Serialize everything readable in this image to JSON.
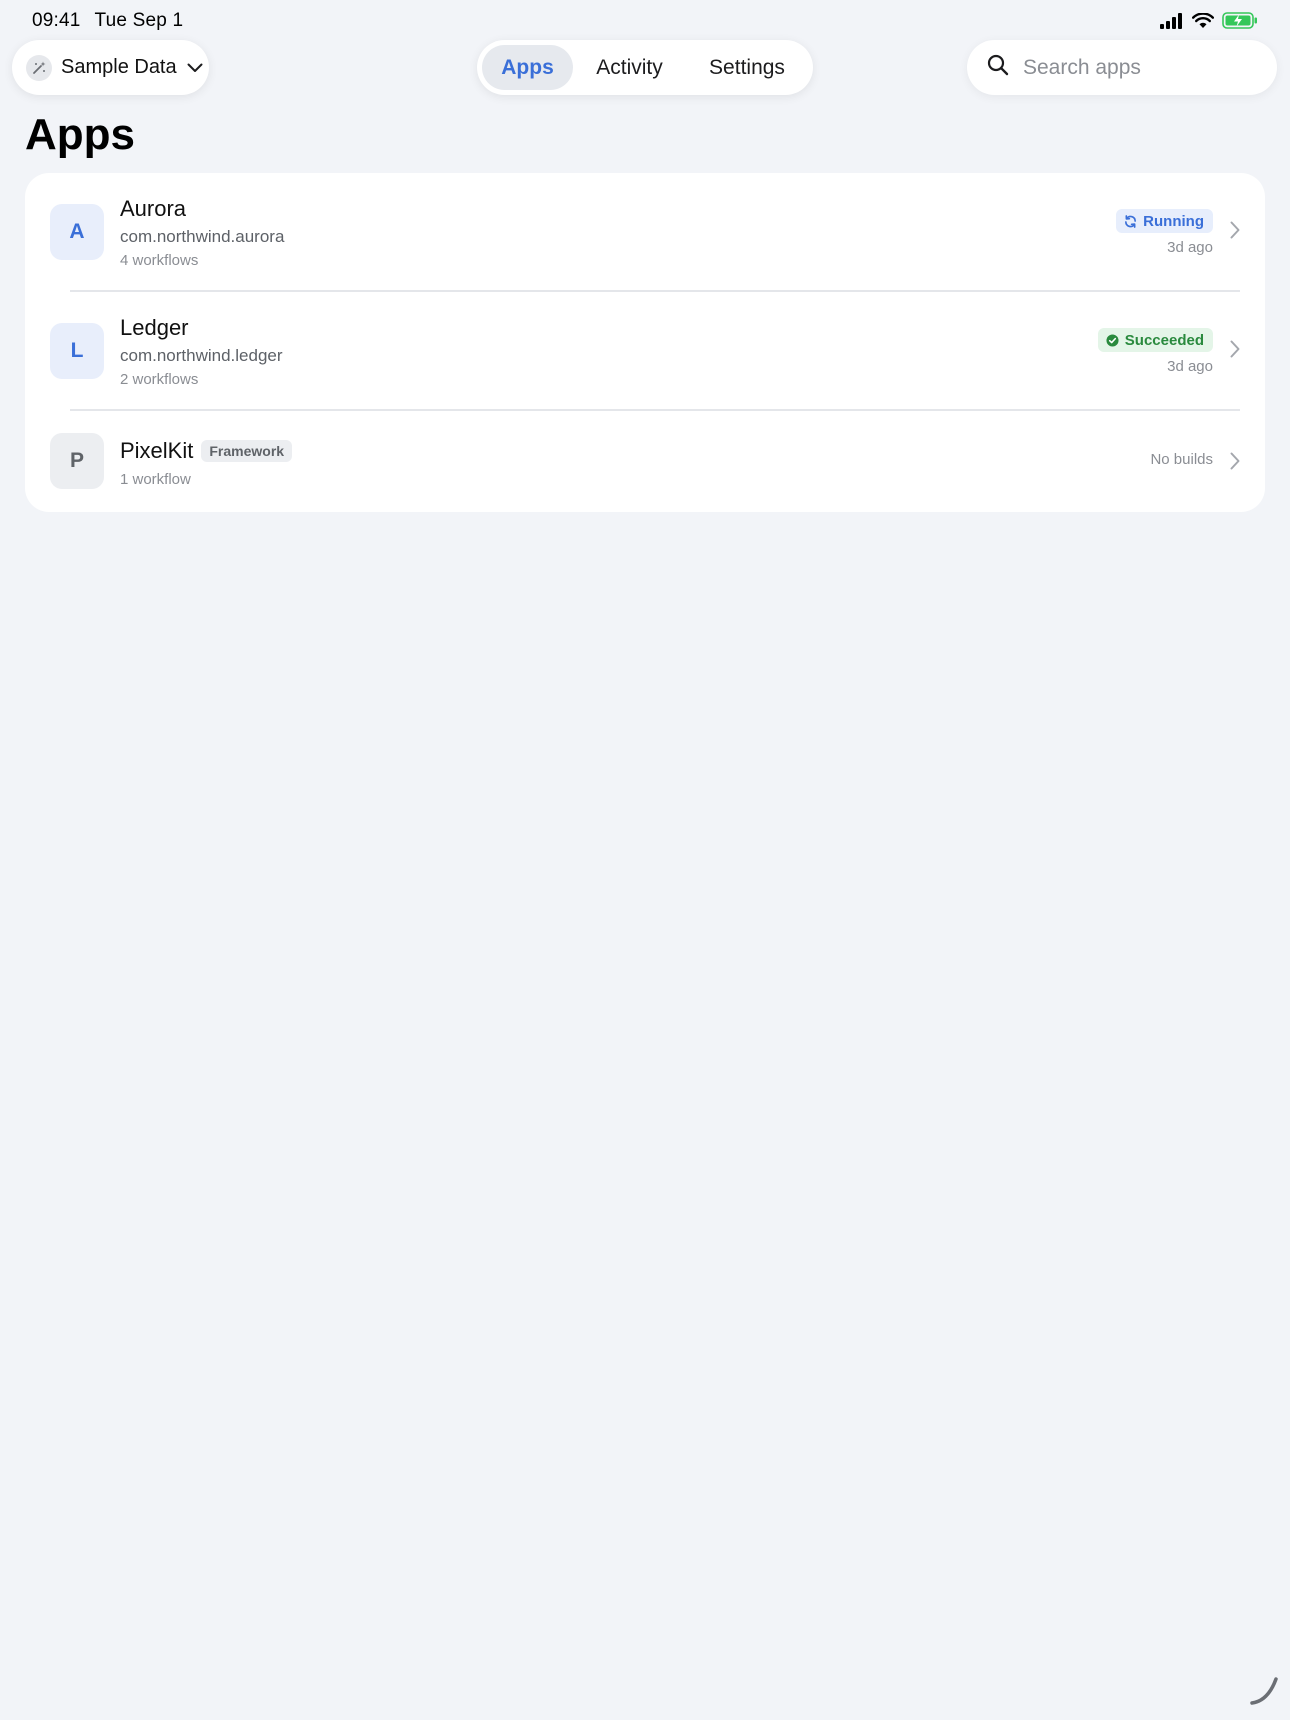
{
  "status_bar": {
    "time": "09:41",
    "date": "Tue Sep 1",
    "icons": [
      "cellular-signal-icon",
      "wifi-icon",
      "battery-charging-icon"
    ]
  },
  "account": {
    "label": "Sample Data",
    "icon": "sparkle-wand-icon"
  },
  "tabs": [
    {
      "label": "Apps",
      "active": true
    },
    {
      "label": "Activity",
      "active": false
    },
    {
      "label": "Settings",
      "active": false
    }
  ],
  "search": {
    "placeholder": "Search apps",
    "value": ""
  },
  "page": {
    "title": "Apps"
  },
  "apps": [
    {
      "initial": "A",
      "name": "Aurora",
      "bundle_id": "com.northwind.aurora",
      "workflows": "4 workflows",
      "status": "Running",
      "time_ago": "3d ago"
    },
    {
      "initial": "L",
      "name": "Ledger",
      "bundle_id": "com.northwind.ledger",
      "workflows": "2 workflows",
      "status": "Succeeded",
      "time_ago": "3d ago"
    },
    {
      "initial": "P",
      "name": "PixelKit",
      "tag": "Framework",
      "workflows": "1 workflow",
      "status_text": "No builds"
    }
  ],
  "colors": {
    "accent": "#3a6fd8",
    "success": "#2a8a3e",
    "background": "#f2f4f8",
    "card": "#ffffff",
    "muted": "#8a8d93"
  }
}
